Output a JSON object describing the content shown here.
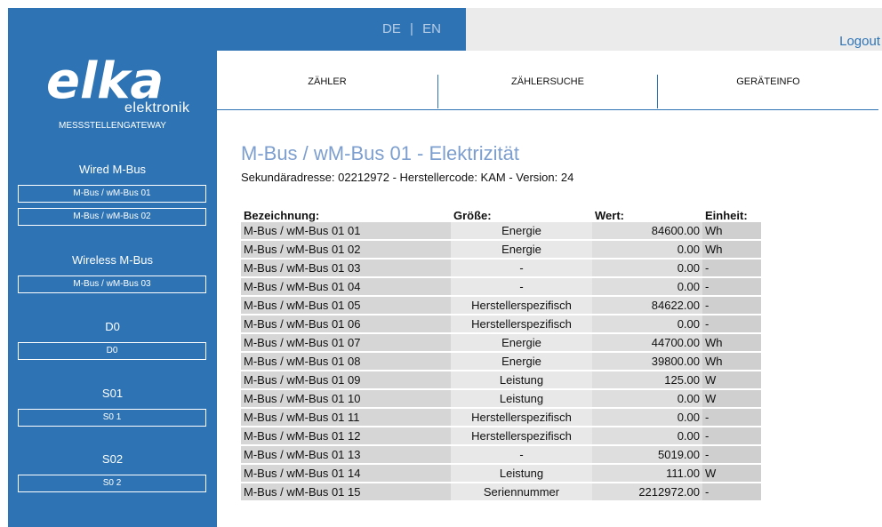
{
  "header": {
    "lang_de": "DE",
    "lang_sep": "|",
    "lang_en": "EN",
    "logout_label": "Logout"
  },
  "brand": {
    "logo_text": "elka",
    "logo_sub": "elektronik",
    "product": "MESSSTELLENGATEWAY"
  },
  "sidebar": {
    "groups": [
      {
        "title": "Wired M-Bus",
        "items": [
          "M-Bus / wM-Bus 01",
          "M-Bus / wM-Bus 02"
        ]
      },
      {
        "title": "Wireless M-Bus",
        "items": [
          "M-Bus / wM-Bus 03"
        ]
      },
      {
        "title": "D0",
        "items": [
          "D0"
        ]
      },
      {
        "title": "S01",
        "items": [
          "S0 1"
        ]
      },
      {
        "title": "S02",
        "items": [
          "S0 2"
        ]
      }
    ]
  },
  "nav": {
    "items": [
      "ZÄHLER",
      "ZÄHLERSUCHE",
      "GERÄTEINFO"
    ]
  },
  "main": {
    "title": "M-Bus / wM-Bus 01 - Elektrizität",
    "subtitle": "Sekundäradresse: 02212972 - Herstellercode: KAM - Version: 24",
    "columns": [
      "Bezeichnung:",
      "Größe:",
      "Wert:",
      "Einheit:"
    ],
    "rows": [
      [
        "M-Bus / wM-Bus 01 01",
        "Energie",
        "84600.00",
        "Wh"
      ],
      [
        "M-Bus / wM-Bus 01 02",
        "Energie",
        "0.00",
        "Wh"
      ],
      [
        "M-Bus / wM-Bus 01 03",
        "-",
        "0.00",
        "-"
      ],
      [
        "M-Bus / wM-Bus 01 04",
        "-",
        "0.00",
        "-"
      ],
      [
        "M-Bus / wM-Bus 01 05",
        "Herstellerspezifisch",
        "84622.00",
        "-"
      ],
      [
        "M-Bus / wM-Bus 01 06",
        "Herstellerspezifisch",
        "0.00",
        "-"
      ],
      [
        "M-Bus / wM-Bus 01 07",
        "Energie",
        "44700.00",
        "Wh"
      ],
      [
        "M-Bus / wM-Bus 01 08",
        "Energie",
        "39800.00",
        "Wh"
      ],
      [
        "M-Bus / wM-Bus 01 09",
        "Leistung",
        "125.00",
        "W"
      ],
      [
        "M-Bus / wM-Bus 01 10",
        "Leistung",
        "0.00",
        "W"
      ],
      [
        "M-Bus / wM-Bus 01 11",
        "Herstellerspezifisch",
        "0.00",
        "-"
      ],
      [
        "M-Bus / wM-Bus 01 12",
        "Herstellerspezifisch",
        "0.00",
        "-"
      ],
      [
        "M-Bus / wM-Bus 01 13",
        "-",
        "5019.00",
        "-"
      ],
      [
        "M-Bus / wM-Bus 01 14",
        "Leistung",
        "111.00",
        "W"
      ],
      [
        "M-Bus / wM-Bus 01 15",
        "Seriennummer",
        "2212972.00",
        "-"
      ]
    ]
  },
  "colors": {
    "brand_blue": "#2e74b5",
    "title_blue": "#7d9fcf",
    "header_grey": "#ebebeb"
  }
}
